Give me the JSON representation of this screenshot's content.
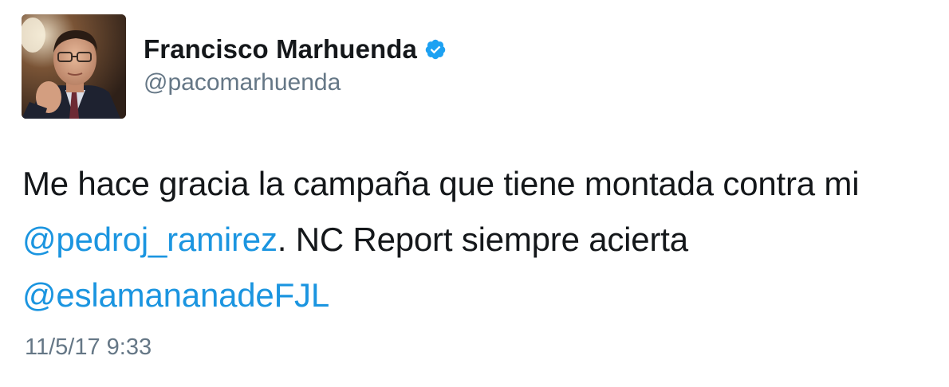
{
  "user": {
    "display_name": "Francisco Marhuenda",
    "handle": "@pacomarhuenda",
    "verified_icon": "verified-badge-icon",
    "avatar": "profile-photo"
  },
  "tweet": {
    "line1": "Me hace gracia la campaña que tiene montada contra mi",
    "mention1": "@pedroj_ramirez",
    "line2_rest": ". NC Report siempre acierta",
    "mention2": "@eslamananadeFJL",
    "timestamp": "11/5/17 9:33"
  },
  "colors": {
    "text": "#14171a",
    "secondary": "#657786",
    "link": "#1b95e0",
    "verified": "#1da1f2"
  }
}
